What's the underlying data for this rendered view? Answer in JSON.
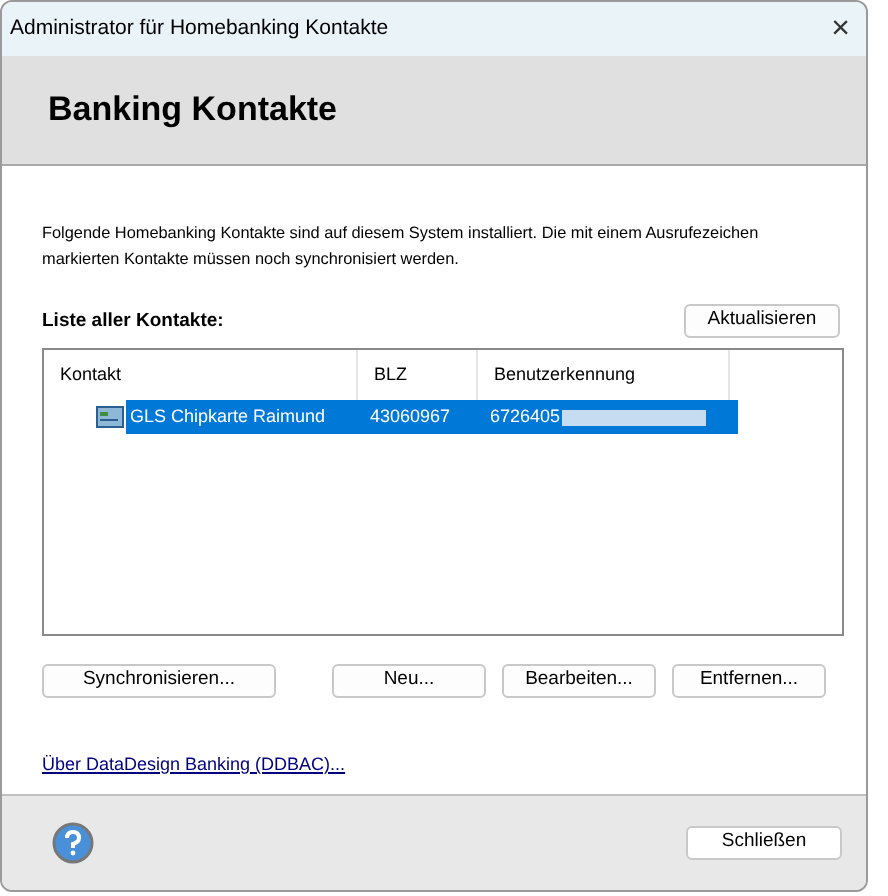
{
  "window": {
    "title": "Administrator für Homebanking Kontakte",
    "close": "×"
  },
  "header": {
    "title": "Banking Kontakte"
  },
  "intro": "Folgende Homebanking Kontakte sind auf diesem System installiert. Die mit einem Ausrufezeichen markierten Kontakte müssen noch synchronisiert werden.",
  "list": {
    "label": "Liste aller Kontakte:",
    "refresh_button": "Aktualisieren",
    "columns": [
      "Kontakt",
      "BLZ",
      "Benutzerkennung"
    ],
    "rows": [
      {
        "contact": "GLS Chipkarte Raimund",
        "blz": "43060967",
        "user_id": "6726405",
        "redacted": true,
        "selected": true
      }
    ]
  },
  "actions": [
    "Synchronisieren...",
    "Neu...",
    "Bearbeiten...",
    "Entfernen..."
  ],
  "about_link": "Über DataDesign Banking (DDBAC)...",
  "footer": {
    "close_button": "Schließen"
  }
}
